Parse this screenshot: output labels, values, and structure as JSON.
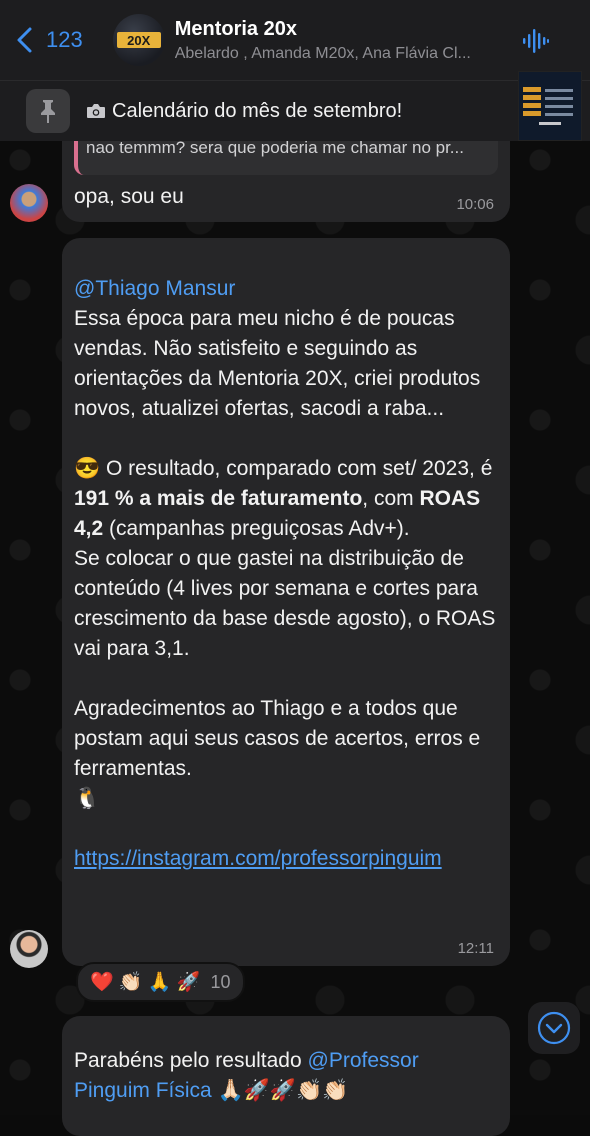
{
  "header": {
    "back_count": "123",
    "title": "Mentoria 20x",
    "subtitle": "Abelardo , Amanda M20x, Ana Flávia Cl...",
    "group_logo_text": "20X"
  },
  "pinned": {
    "text": "Calendário do mês de setembro!"
  },
  "messages": {
    "reply_quote": "nao temmm? sera que poderia me chamar no pr...",
    "m1": {
      "text": "opa, sou eu",
      "time": "10:06"
    },
    "m2": {
      "mention": "@Thiago Mansur",
      "p1": "Essa época para meu nicho é de poucas vendas. Não satisfeito e seguindo as orientações da Mentoria 20X, criei produtos novos, atualizei ofertas, sacodi a raba...",
      "p2_emoji": "😎",
      "p2_a": " O resultado, comparado com set/ 2023, é ",
      "p2_bold1": "191 % a mais de faturamento",
      "p2_b": ", com ",
      "p2_bold2": "ROAS 4,2",
      "p2_c": " (campanhas preguiçosas Adv+).",
      "p3": "Se colocar o que gastei na distribuição de conteúdo (4 lives por semana e cortes para crescimento da base desde agosto), o ROAS vai para 3,1.",
      "p4": "Agradecimentos ao Thiago e a todos que postam aqui seus casos de acertos, erros e ferramentas.",
      "p5_emoji": "🐧",
      "link": "https://instagram.com/professorpinguim",
      "time": "12:11"
    },
    "reactions": {
      "emojis": "❤️ 👏🏻 🙏 🚀",
      "count": "10"
    },
    "m3": {
      "text": "Parabéns pelo resultado ",
      "mention": "@Professor Pinguim Física",
      "emojis": " 🙏🏻🚀🚀👏🏻👏🏻"
    }
  },
  "colors": {
    "accent": "#3e8ff0",
    "bubble": "#262628",
    "header": "#1d1d1f",
    "link": "#4f9df3"
  }
}
